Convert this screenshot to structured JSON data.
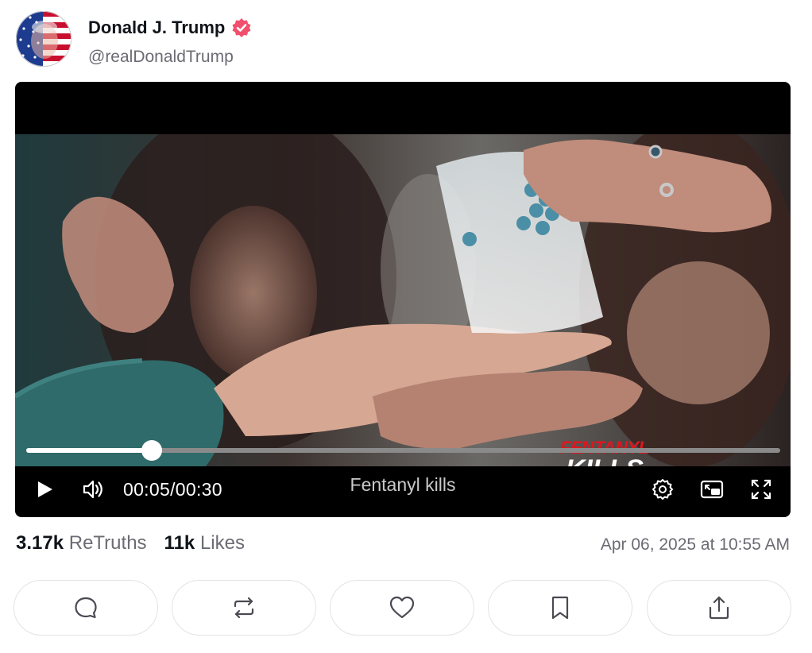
{
  "author": {
    "display_name": "Donald J. Trump",
    "handle": "@realDonaldTrump",
    "verified": true,
    "avatar_icon": "flag-portrait-avatar",
    "verified_color": "#f0506e"
  },
  "video": {
    "overlay_line1": "FENTANYL",
    "overlay_line2": "KILLS",
    "overlay_line1_color": "#e0161e",
    "current_time": "00:05",
    "separator": "/",
    "duration": "00:30",
    "progress_fraction": 0.1667,
    "caption": "Fentanyl kills",
    "controls": {
      "play_icon": "play-icon",
      "volume_icon": "volume-icon",
      "settings_icon": "gear-icon",
      "pip_icon": "picture-in-picture-icon",
      "fullscreen_icon": "fullscreen-icon"
    }
  },
  "stats": {
    "retruths_count": "3.17k",
    "retruths_label": "ReTruths",
    "likes_count": "11k",
    "likes_label": "Likes"
  },
  "timestamp": "Apr 06, 2025 at 10:55 AM",
  "actions": [
    {
      "name": "reply",
      "icon": "comment-icon"
    },
    {
      "name": "retruth",
      "icon": "repost-icon"
    },
    {
      "name": "like",
      "icon": "heart-icon"
    },
    {
      "name": "bookmark",
      "icon": "bookmark-icon"
    },
    {
      "name": "share",
      "icon": "share-icon"
    }
  ]
}
